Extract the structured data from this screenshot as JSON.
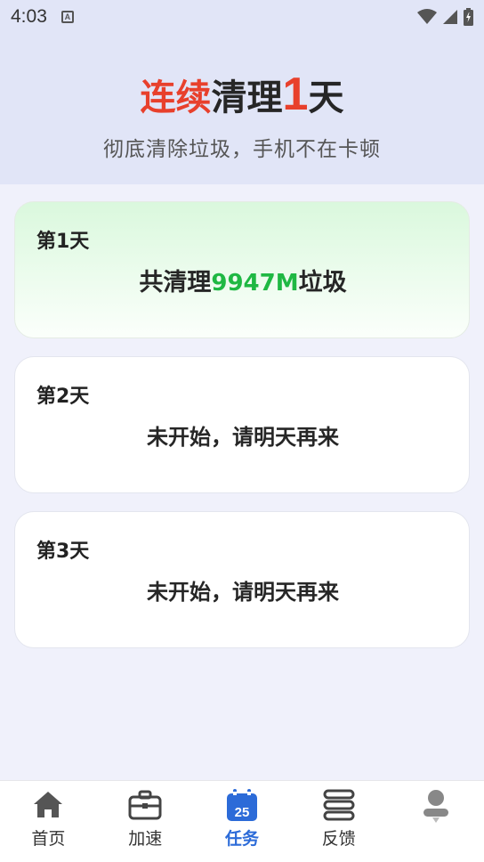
{
  "status_bar": {
    "time": "4:03",
    "notification_glyph": "A"
  },
  "header": {
    "title_highlight": "连续",
    "title_mid": "清理",
    "title_days": "1",
    "title_unit": "天",
    "subtitle": "彻底清除垃圾，手机不在卡顿"
  },
  "days": [
    {
      "day": "第1天",
      "prefix": "共清理",
      "amount": "9947M",
      "suffix": "垃圾"
    },
    {
      "day": "第2天",
      "message": "未开始，请明天再来"
    },
    {
      "day": "第3天",
      "message": "未开始，请明天再来"
    }
  ],
  "nav": [
    {
      "label": "首页",
      "icon": "home-icon"
    },
    {
      "label": "加速",
      "icon": "briefcase-icon"
    },
    {
      "label": "任务",
      "icon": "calendar-icon",
      "badge": "25",
      "active": true
    },
    {
      "label": "反馈",
      "icon": "feedback-icon"
    },
    {
      "label": "",
      "icon": "user-icon"
    }
  ],
  "colors": {
    "accent_red": "#e8402c",
    "accent_green": "#1fb843",
    "active_blue": "#2c6bd8"
  }
}
